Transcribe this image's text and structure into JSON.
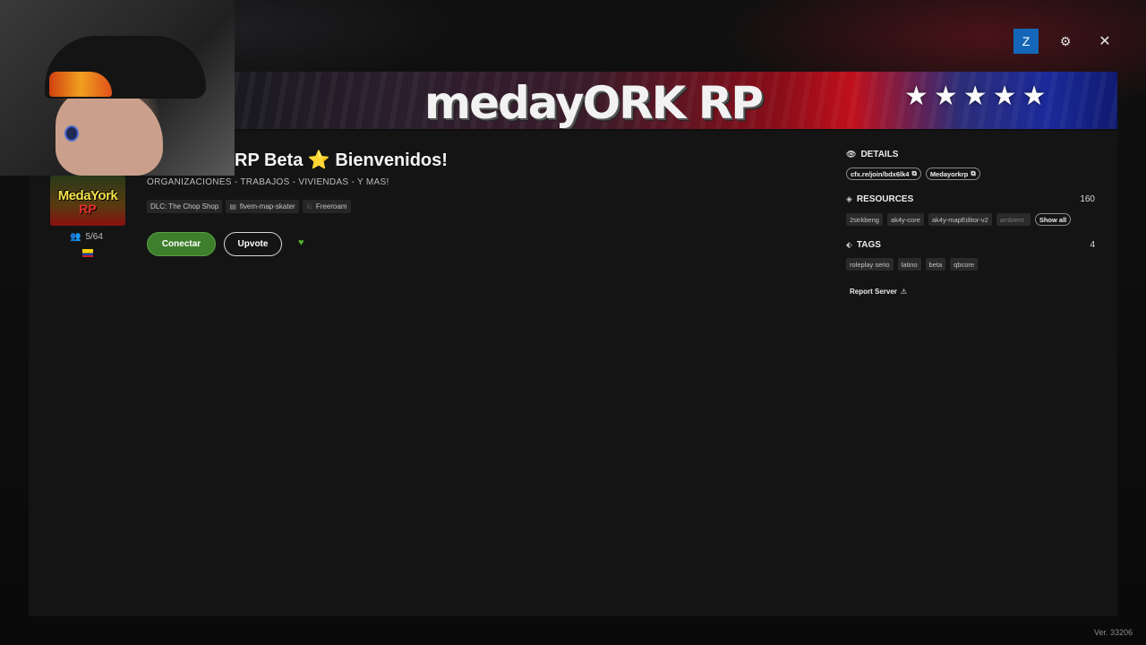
{
  "window": {
    "avatar_letter": "Z",
    "gear_icon": "⚙",
    "close_icon": "✕"
  },
  "banner": {
    "title": "medayORK RP",
    "stars": "★★★★★"
  },
  "server": {
    "logo_text": "MedaYork",
    "logo_sub": "RP",
    "players": "5/64",
    "title": "RP Beta",
    "title_star": "⭐",
    "title_welcome": "Bienvenidos!",
    "subtitle": "ORGANIZACIONES - TRABAJOS - VIVIENDAS - Y MAS!",
    "chips": [
      {
        "icon": "",
        "label": "DLC: The Chop Shop"
      },
      {
        "icon": "▤",
        "label": "fivem-map-skater"
      },
      {
        "icon": "♘",
        "label": "Freeroam"
      }
    ],
    "connect_label": "Conectar",
    "upvote_label": "Upvote",
    "heart": "♥"
  },
  "details": {
    "heading": "DETAILS",
    "join_url": "cfx.re/join/bdx6lk4",
    "join_icon": "⧉",
    "discord": "Medayorkrp",
    "discord_icon": "⧉"
  },
  "resources": {
    "heading": "RESOURCES",
    "count": "160",
    "items": [
      "2strkbeng",
      "ak4y-core",
      "ak4y-mapEditor-v2",
      "ambient"
    ],
    "show_all": "Show all"
  },
  "tags": {
    "heading": "TAGS",
    "count": "4",
    "items": [
      "roleplay serio",
      "latino",
      "beta",
      "qbcore"
    ]
  },
  "report": {
    "label": "Report Server",
    "icon": "⚠"
  },
  "version": "Ver. 33206",
  "colors": {
    "connect": "#3d7f2c",
    "avatar": "#1467b8",
    "heart": "#52b030",
    "star": "#f5c518"
  }
}
